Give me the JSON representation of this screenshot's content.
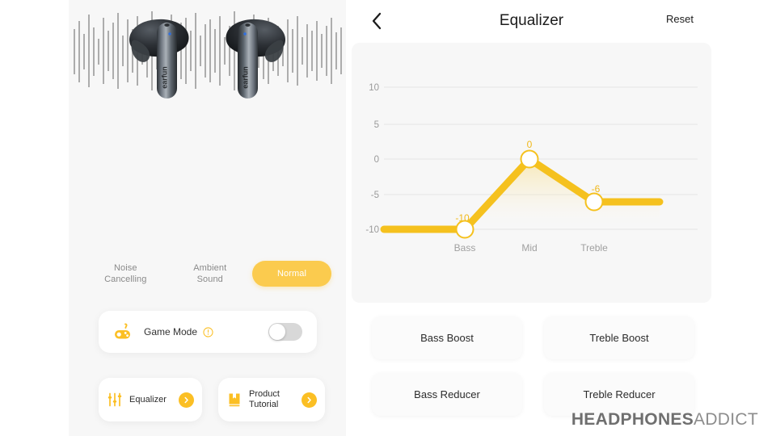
{
  "brand": {
    "watermark_bold": "HEADPHONES",
    "watermark_light": "ADDICT"
  },
  "colors": {
    "accent": "#fbcb4e",
    "accent_strong": "#f5c11e",
    "panel_bg": "#f7f7f7",
    "card_bg": "#ffffff",
    "text_primary": "#1c1c1c",
    "text_muted": "#8a8a8a",
    "toggle_off": "#d8d8d8"
  },
  "left_screen": {
    "product": {
      "device_name": "earfun",
      "image_alt": "Black wireless earbuds on audio waveform background"
    },
    "modes": [
      {
        "label": "Noise\nCancelling",
        "active": false
      },
      {
        "label": "Ambient\nSound",
        "active": false
      },
      {
        "label": "Normal",
        "active": true
      }
    ],
    "game_mode": {
      "label": "Game Mode",
      "icon": "gamepad-icon",
      "info_icon": "info-circle-icon",
      "toggle_state": "off"
    },
    "cards": [
      {
        "label": "Equalizer",
        "icon": "sliders-icon",
        "chevron": "chevron-right-icon"
      },
      {
        "label": "Product\nTutorial",
        "icon": "book-icon",
        "chevron": "chevron-right-icon"
      }
    ]
  },
  "right_screen": {
    "header": {
      "back_icon": "chevron-left-icon",
      "title": "Equalizer",
      "reset_label": "Reset"
    },
    "presets": [
      {
        "label": "Bass Boost"
      },
      {
        "label": "Treble Boost"
      },
      {
        "label": "Bass Reducer"
      },
      {
        "label": "Treble Reducer"
      }
    ]
  },
  "chart_data": {
    "type": "line",
    "title": "Equalizer",
    "xlabel": "",
    "ylabel": "",
    "categories": [
      "Bass",
      "Mid",
      "Treble"
    ],
    "values": [
      -10,
      0,
      -6
    ],
    "point_labels": [
      "-10",
      "0",
      "-6"
    ],
    "ylim": [
      -12,
      12
    ],
    "yticks": [
      10,
      5,
      0,
      -5,
      -10
    ],
    "ytick_labels": [
      "10",
      "5",
      "0",
      "-5",
      "-10"
    ],
    "grid": true,
    "legend": false,
    "line_color": "#f5c11e",
    "marker_fill": "#ffffff",
    "marker_stroke": "#f5c11e",
    "fill_under": true,
    "flat_extension_left": true,
    "flat_extension_right": true
  }
}
